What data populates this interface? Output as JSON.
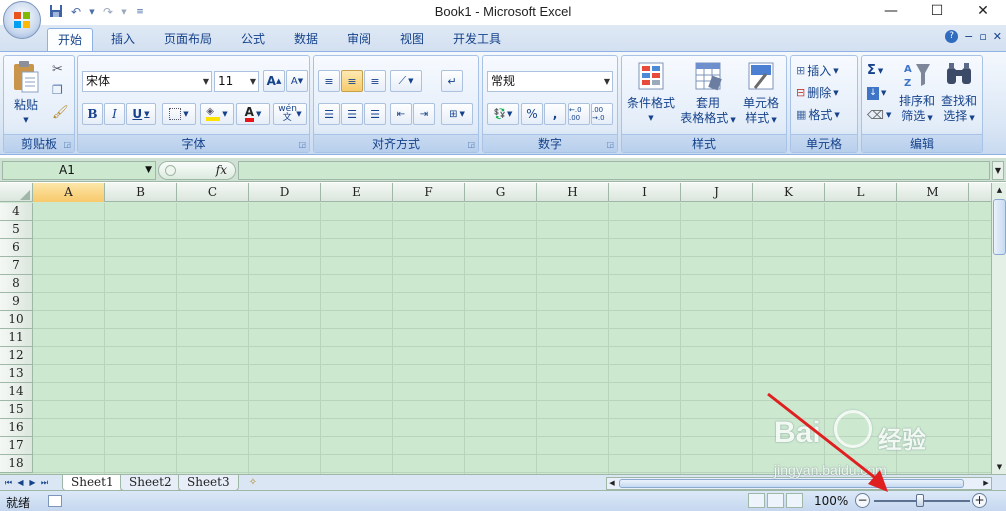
{
  "titlebar": {
    "title": "Book1 - Microsoft Excel",
    "minimize": "—",
    "maximize": "☐",
    "close": "✕"
  },
  "tabs": [
    "开始",
    "插入",
    "页面布局",
    "公式",
    "数据",
    "审阅",
    "视图",
    "开发工具"
  ],
  "ribbon": {
    "clipboard": {
      "label": "剪贴板",
      "paste": "粘贴"
    },
    "font": {
      "label": "字体",
      "font_name": "宋体",
      "font_size": "11",
      "bold": "B",
      "italic": "I",
      "underline": "U",
      "grow": "A",
      "shrink": "A",
      "phonetic": "wén 文",
      "font_color": "A"
    },
    "alignment": {
      "label": "对齐方式"
    },
    "number": {
      "label": "数字",
      "format": "常规",
      "percent": "%",
      "comma": ",",
      "inc_decimal": "←.0 .00",
      "dec_decimal": ".00 →.0"
    },
    "styles": {
      "label": "样式",
      "conditional": "条件格式",
      "table_format_1": "套用",
      "table_format_2": "表格格式",
      "cell_styles_1": "单元格",
      "cell_styles_2": "样式"
    },
    "cells": {
      "label": "单元格",
      "insert": "插入",
      "delete": "删除",
      "format": "格式"
    },
    "editing": {
      "label": "编辑",
      "sum": "Σ",
      "sort_1": "排序和",
      "sort_2": "筛选",
      "find_1": "查找和",
      "find_2": "选择"
    }
  },
  "formula_bar": {
    "name_box": "A1",
    "fx": "fx",
    "value": ""
  },
  "grid": {
    "columns": [
      "A",
      "B",
      "C",
      "D",
      "E",
      "F",
      "G",
      "H",
      "I",
      "J",
      "K",
      "L",
      "M"
    ],
    "rows": [
      "4",
      "5",
      "6",
      "7",
      "8",
      "9",
      "10",
      "11",
      "12",
      "13",
      "14",
      "15",
      "16",
      "17",
      "18"
    ],
    "selected_column": "A"
  },
  "sheets": [
    "Sheet1",
    "Sheet2",
    "Sheet3"
  ],
  "status": {
    "ready": "就绪",
    "zoom": "100%",
    "zoom_minus": "−",
    "zoom_plus": "+"
  },
  "watermark": {
    "brand": "Bai",
    "brand2": "经验",
    "url": "jingyan.baidu.com"
  },
  "colors": {
    "accent": "#15428b",
    "grid_bg": "#cce8cf",
    "ribbon": "#dbe7f5",
    "arrow": "#e02020"
  }
}
